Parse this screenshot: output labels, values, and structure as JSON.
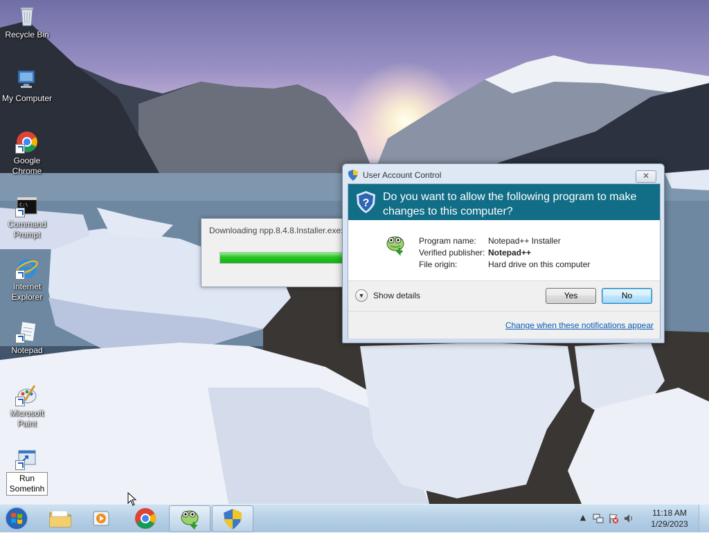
{
  "desktop": {
    "icons": [
      {
        "label": "Recycle Bin",
        "icon": "recycle-bin-icon"
      },
      {
        "label": "My Computer",
        "icon": "computer-icon"
      },
      {
        "label": "Google Chrome",
        "icon": "chrome-icon"
      },
      {
        "label": "Command Prompt",
        "icon": "command-prompt-icon"
      },
      {
        "label": "Internet Explorer",
        "icon": "internet-explorer-icon"
      },
      {
        "label": "Notepad",
        "icon": "notepad-icon"
      },
      {
        "label": "Microsoft Paint",
        "icon": "paint-icon"
      },
      {
        "label": "Run Sometinh",
        "icon": "run-icon"
      }
    ]
  },
  "download_window": {
    "title": "Downloading npp.8.4.8.Installer.exe:",
    "progress": 0.85
  },
  "uac": {
    "title": "User Account Control",
    "close_label": "✕",
    "question": "Do you want to allow the following program to make changes to this computer?",
    "properties": [
      {
        "key": "Program name:",
        "value": "Notepad++ Installer",
        "bold": false
      },
      {
        "key": "Verified publisher:",
        "value": "Notepad++",
        "bold": true
      },
      {
        "key": "File origin:",
        "value": "Hard drive on this computer",
        "bold": false
      }
    ],
    "show_details": "Show details",
    "yes": "Yes",
    "no": "No",
    "notification_link": "Change when these notifications appear"
  },
  "taskbar": {
    "items": [
      {
        "name": "file-explorer",
        "icon": "folder-icon",
        "active": false
      },
      {
        "name": "media-player",
        "icon": "media-player-icon",
        "active": false
      },
      {
        "name": "chrome",
        "icon": "chrome-icon",
        "active": false
      },
      {
        "name": "notepad-plus-plus-installer",
        "icon": "notepad-plus-plus-icon",
        "active": true
      },
      {
        "name": "user-account-control",
        "icon": "uac-shield-icon",
        "active": true
      }
    ],
    "clock_time": "11:18 AM",
    "clock_date": "1/29/2023"
  },
  "colors": {
    "uac_banner": "#126e87",
    "link": "#0a5bb6",
    "progress_green": "#28c424"
  }
}
